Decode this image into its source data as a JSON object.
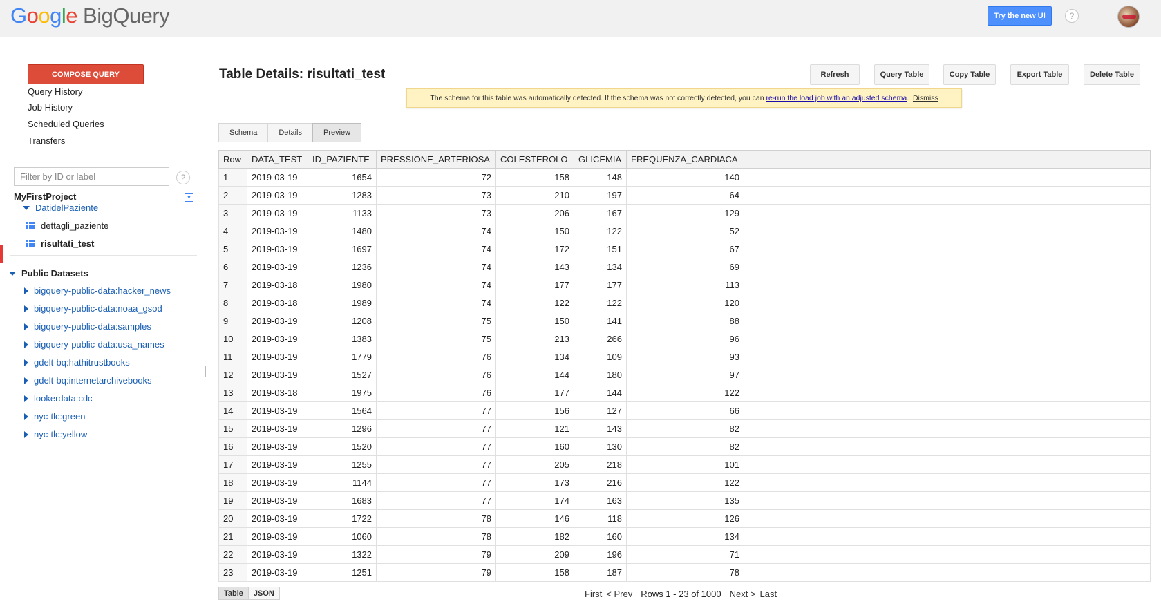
{
  "header": {
    "logo_letters": [
      "G",
      "o",
      "o",
      "g",
      "l",
      "e"
    ],
    "product": "BigQuery",
    "try_new_ui": "Try the new UI",
    "help": "?"
  },
  "sidebar": {
    "compose": "COMPOSE QUERY",
    "nav": [
      "Query History",
      "Job History",
      "Scheduled Queries",
      "Transfers"
    ],
    "filter_placeholder": "Filter by ID or label",
    "help": "?",
    "project": "MyFirstProject",
    "dataset": "DatidelPaziente",
    "tables": [
      "dettagli_paziente",
      "risultati_test"
    ],
    "public_header": "Public Datasets",
    "public_datasets": [
      "bigquery-public-data:hacker_news",
      "bigquery-public-data:noaa_gsod",
      "bigquery-public-data:samples",
      "bigquery-public-data:usa_names",
      "gdelt-bq:hathitrustbooks",
      "gdelt-bq:internetarchivebooks",
      "lookerdata:cdc",
      "nyc-tlc:green",
      "nyc-tlc:yellow"
    ]
  },
  "main": {
    "title": "Table Details: risultati_test",
    "buttons": [
      "Refresh",
      "Query Table",
      "Copy Table",
      "Export Table",
      "Delete Table"
    ],
    "notice": {
      "text": "The schema for this table was automatically detected. If the schema was not correctly detected, you can",
      "link": "re-run the load job with an adjusted schema",
      "period": ".",
      "dismiss": "Dismiss"
    },
    "tabs": [
      "Schema",
      "Details",
      "Preview"
    ],
    "active_tab": "Preview",
    "columns": [
      "Row",
      "DATA_TEST",
      "ID_PAZIENTE",
      "PRESSIONE_ARTERIOSA",
      "COLESTEROLO",
      "GLICEMIA",
      "FREQUENZA_CARDIACA"
    ],
    "rows": [
      [
        "1",
        "2019-03-19",
        "1654",
        "72",
        "158",
        "148",
        "140"
      ],
      [
        "2",
        "2019-03-19",
        "1283",
        "73",
        "210",
        "197",
        "64"
      ],
      [
        "3",
        "2019-03-19",
        "1133",
        "73",
        "206",
        "167",
        "129"
      ],
      [
        "4",
        "2019-03-19",
        "1480",
        "74",
        "150",
        "122",
        "52"
      ],
      [
        "5",
        "2019-03-19",
        "1697",
        "74",
        "172",
        "151",
        "67"
      ],
      [
        "6",
        "2019-03-19",
        "1236",
        "74",
        "143",
        "134",
        "69"
      ],
      [
        "7",
        "2019-03-18",
        "1980",
        "74",
        "177",
        "177",
        "113"
      ],
      [
        "8",
        "2019-03-18",
        "1989",
        "74",
        "122",
        "122",
        "120"
      ],
      [
        "9",
        "2019-03-19",
        "1208",
        "75",
        "150",
        "141",
        "88"
      ],
      [
        "10",
        "2019-03-19",
        "1383",
        "75",
        "213",
        "266",
        "96"
      ],
      [
        "11",
        "2019-03-19",
        "1779",
        "76",
        "134",
        "109",
        "93"
      ],
      [
        "12",
        "2019-03-19",
        "1527",
        "76",
        "144",
        "180",
        "97"
      ],
      [
        "13",
        "2019-03-18",
        "1975",
        "76",
        "177",
        "144",
        "122"
      ],
      [
        "14",
        "2019-03-19",
        "1564",
        "77",
        "156",
        "127",
        "66"
      ],
      [
        "15",
        "2019-03-19",
        "1296",
        "77",
        "121",
        "143",
        "82"
      ],
      [
        "16",
        "2019-03-19",
        "1520",
        "77",
        "160",
        "130",
        "82"
      ],
      [
        "17",
        "2019-03-19",
        "1255",
        "77",
        "205",
        "218",
        "101"
      ],
      [
        "18",
        "2019-03-19",
        "1144",
        "77",
        "173",
        "216",
        "122"
      ],
      [
        "19",
        "2019-03-19",
        "1683",
        "77",
        "174",
        "163",
        "135"
      ],
      [
        "20",
        "2019-03-19",
        "1722",
        "78",
        "146",
        "118",
        "126"
      ],
      [
        "21",
        "2019-03-19",
        "1060",
        "78",
        "182",
        "160",
        "134"
      ],
      [
        "22",
        "2019-03-19",
        "1322",
        "79",
        "209",
        "196",
        "71"
      ],
      [
        "23",
        "2019-03-19",
        "1251",
        "79",
        "158",
        "187",
        "78"
      ]
    ],
    "view_toggle": [
      "Table",
      "JSON"
    ],
    "pager": {
      "first": "First",
      "prev": "< Prev",
      "info": "Rows 1 - 23 of 1000",
      "next": "Next >",
      "last": "Last"
    }
  },
  "colors": {
    "compose": "#dd4b39",
    "try_btn": "#4d90fe",
    "link_blue": "#1a5fb4",
    "notice_bg": "#fff3c4",
    "active_indicator": "#e53935"
  }
}
